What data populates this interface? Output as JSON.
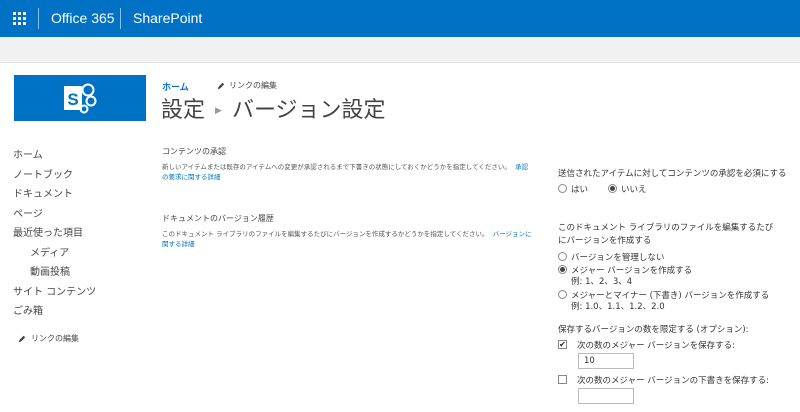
{
  "suitebar": {
    "app_launcher_icon": "waffle-icon",
    "office_label": "Office 365",
    "product_label": "SharePoint",
    "color": "#0072c6"
  },
  "logo": {
    "icon": "sharepoint-logo-icon",
    "color": "#0072c6"
  },
  "quicklaunch": {
    "items": [
      {
        "label": "ホーム",
        "sub": false
      },
      {
        "label": "ノートブック",
        "sub": false
      },
      {
        "label": "ドキュメント",
        "sub": false
      },
      {
        "label": "ページ",
        "sub": false
      },
      {
        "label": "最近使った項目",
        "sub": false
      },
      {
        "label": "メディア",
        "sub": true
      },
      {
        "label": "動画投稿",
        "sub": true
      },
      {
        "label": "サイト コンテンツ",
        "sub": false
      },
      {
        "label": "ごみ箱",
        "sub": false
      }
    ],
    "edit_links_label": "リンクの編集"
  },
  "header": {
    "breadcrumb_home": "ホーム",
    "edit_links_label": "リンクの編集",
    "title_parent": "設定",
    "title_current": "バージョン設定"
  },
  "content_approval": {
    "title": "コンテンツの承認",
    "description": "新しいアイテムまたは既存のアイテムへの変更が承認されるまで下書きの状態にしておくかどうかを指定してください。",
    "link_text": "承認の要求に関する詳細",
    "question": "送信されたアイテムに対してコンテンツの承認を必須にする",
    "options": [
      "はい",
      "いいえ"
    ],
    "selected": "いいえ"
  },
  "version_history": {
    "title": "ドキュメントのバージョン履歴",
    "description": "このドキュメント ライブラリのファイルを編集するたびにバージョンを作成するかどうかを指定してください。",
    "link_text": "バージョンに関する詳細",
    "question": "このドキュメント ライブラリのファイルを編集するたびにバージョンを作成する",
    "options": [
      {
        "label": "バージョンを管理しない",
        "example": ""
      },
      {
        "label": "メジャー バージョンを作成する",
        "example": "例: 1、2、3、4"
      },
      {
        "label": "メジャーとマイナー (下書き) バージョンを作成する",
        "example": "例: 1.0、1.1、1.2、2.0"
      }
    ],
    "selected": "メジャー バージョンを作成する",
    "limit_label": "保存するバージョンの数を限定する (オプション):",
    "keep_major_label": "次の数のメジャー バージョンを保存する:",
    "keep_major_checked": true,
    "keep_major_value": "10",
    "keep_drafts_label": "次の数のメジャー バージョンの下書きを保存する:",
    "keep_drafts_checked": false,
    "keep_drafts_value": ""
  }
}
